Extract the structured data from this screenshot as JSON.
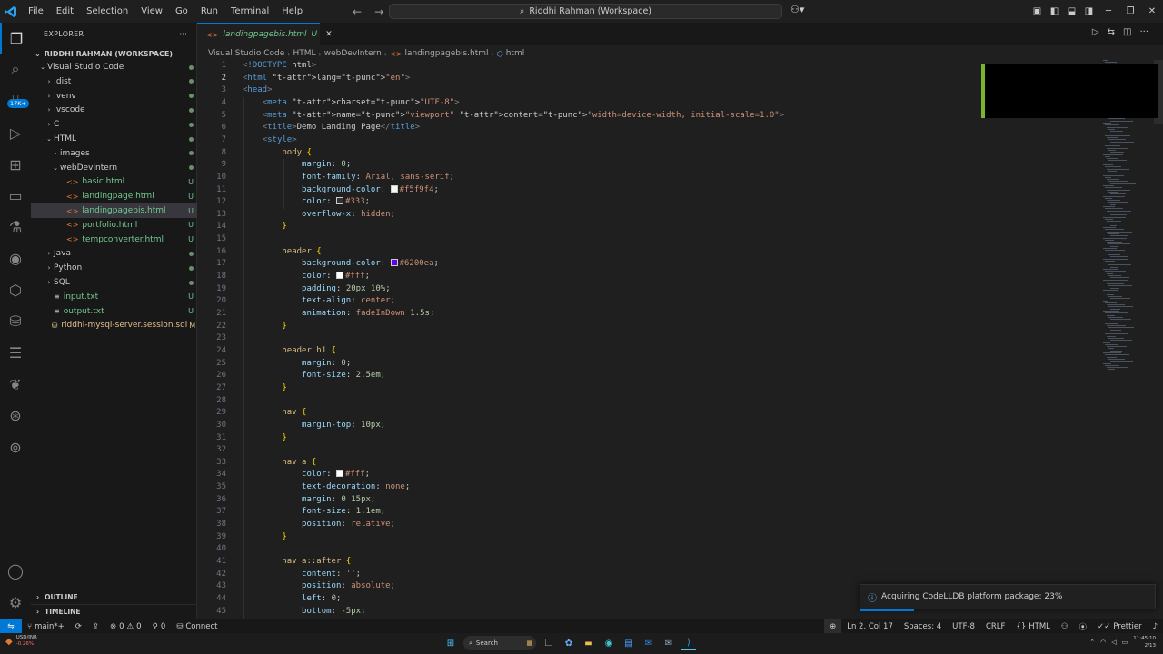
{
  "menu": [
    "File",
    "Edit",
    "Selection",
    "View",
    "Go",
    "Run",
    "Terminal",
    "Help"
  ],
  "command_center": "Riddhi Rahman (Workspace)",
  "explorer": {
    "title": "EXPLORER",
    "workspace": "RIDDHI RAHMAN (WORKSPACE)",
    "items": [
      {
        "label": "Visual Studio Code",
        "status": "",
        "depth": 0,
        "kind": "folder-open"
      },
      {
        "label": ".dist",
        "status": "",
        "depth": 1,
        "kind": "folder"
      },
      {
        "label": ".venv",
        "status": "",
        "depth": 1,
        "kind": "folder"
      },
      {
        "label": ".vscode",
        "status": "",
        "depth": 1,
        "kind": "folder"
      },
      {
        "label": "C",
        "status": "",
        "depth": 1,
        "kind": "folder"
      },
      {
        "label": "HTML",
        "status": "",
        "depth": 1,
        "kind": "folder-open"
      },
      {
        "label": "images",
        "status": "",
        "depth": 2,
        "kind": "folder"
      },
      {
        "label": "webDevIntern",
        "status": "",
        "depth": 2,
        "kind": "folder-open"
      },
      {
        "label": "basic.html",
        "status": "U",
        "depth": 3,
        "kind": "file"
      },
      {
        "label": "landingpage.html",
        "status": "U",
        "depth": 3,
        "kind": "file"
      },
      {
        "label": "landingpagebis.html",
        "status": "U",
        "depth": 3,
        "kind": "file",
        "selected": true
      },
      {
        "label": "portfolio.html",
        "status": "U",
        "depth": 3,
        "kind": "file"
      },
      {
        "label": "tempconverter.html",
        "status": "U",
        "depth": 3,
        "kind": "file"
      },
      {
        "label": "Java",
        "status": "",
        "depth": 1,
        "kind": "folder"
      },
      {
        "label": "Python",
        "status": "",
        "depth": 1,
        "kind": "folder"
      },
      {
        "label": "SQL",
        "status": "",
        "depth": 1,
        "kind": "folder"
      },
      {
        "label": "input.txt",
        "status": "U",
        "depth": 1,
        "kind": "txt"
      },
      {
        "label": "output.txt",
        "status": "U",
        "depth": 1,
        "kind": "txt"
      },
      {
        "label": "riddhi-mysql-server.session.sql",
        "status": "M",
        "depth": 1,
        "kind": "sql"
      }
    ],
    "outline": "OUTLINE",
    "timeline": "TIMELINE"
  },
  "tab": {
    "label": "landingpagebis.html",
    "status": "U"
  },
  "breadcrumbs": [
    "Visual Studio Code",
    "HTML",
    "webDevIntern",
    "landingpagebis.html",
    "html"
  ],
  "code_lines": [
    "<!DOCTYPE html>",
    "<html lang=\"en\">",
    "<head>",
    "    <meta charset=\"UTF-8\">",
    "    <meta name=\"viewport\" content=\"width=device-width, initial-scale=1.0\">",
    "    <title>Demo Landing Page</title>",
    "    <style>",
    "        body {",
    "            margin: 0;",
    "            font-family: Arial, sans-serif;",
    "            background-color: #f5f9f4;",
    "            color: #333;",
    "            overflow-x: hidden;",
    "        }",
    "",
    "        header {",
    "            background-color: #6200ea;",
    "            color: #fff;",
    "            padding: 20px 10%;",
    "            text-align: center;",
    "            animation: fadeInDown 1.5s;",
    "        }",
    "",
    "        header h1 {",
    "            margin: 0;",
    "            font-size: 2.5em;",
    "        }",
    "",
    "        nav {",
    "            margin-top: 10px;",
    "        }",
    "",
    "        nav a {",
    "            color: #fff;",
    "            text-decoration: none;",
    "            margin: 0 15px;",
    "            font-size: 1.1em;",
    "            position: relative;",
    "        }",
    "",
    "        nav a::after {",
    "            content: '';",
    "            position: absolute;",
    "            left: 0;",
    "            bottom: -5px;"
  ],
  "swatches": {
    "11": "#f5f9f4",
    "12": "#333333",
    "17": "#6200ea",
    "18": "#ffffff",
    "34": "#ffffff"
  },
  "current_line": 2,
  "notification": "Acquiring CodeLLDB platform package: 23%",
  "status": {
    "branch": "main*+",
    "errors": "0",
    "warnings": "0",
    "ports": "0",
    "connect": "Connect",
    "cursor": "Ln 2, Col 17",
    "spaces": "Spaces: 4",
    "encoding": "UTF-8",
    "eol": "CRLF",
    "language": "HTML",
    "prettier": "Prettier"
  },
  "taskbar": {
    "ticker_name": "USD/INR",
    "ticker_change": "-0.26%",
    "search": "Search",
    "time": "11:45:10",
    "date": "2/13"
  },
  "colors": {
    "accent": "#0078d4",
    "untracked": "#73c991",
    "modified": "#e2c08d"
  }
}
